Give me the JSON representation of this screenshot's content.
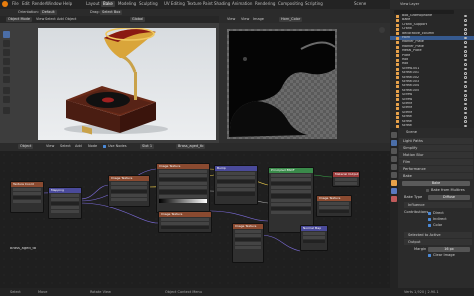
{
  "topbar": {
    "menus": [
      "File",
      "Edit",
      "Render",
      "Window",
      "Help"
    ],
    "workspaces": [
      "Layout",
      "Bake",
      "Modeling",
      "Sculpting",
      "UV Editing",
      "Texture Paint",
      "Shading",
      "Animation",
      "Rendering",
      "Compositing",
      "Scripting"
    ],
    "active_workspace": "Bake",
    "scene_label": "Scene",
    "view_layer_label": "View Layer"
  },
  "viewport_header": {
    "orientation_label": "Orientation:",
    "orientation_value": "Default",
    "drag_label": "Drag:",
    "drag_value": "Select Box",
    "mode": "Object Mode",
    "menus": [
      "View",
      "Select",
      "Add",
      "Object"
    ],
    "global": "Global"
  },
  "image_editor_header": {
    "menus": [
      "View",
      "View",
      "Image"
    ],
    "image_name": "Horn_Color"
  },
  "outliner": {
    "rows": [
      {
        "name": "Box_Gramophone",
        "sel": false,
        "color": "#e8a24a"
      },
      {
        "name": "Bake",
        "sel": false,
        "color": "#e8a24a"
      },
      {
        "name": "Crank_Support",
        "sel": false,
        "color": "#e8a24a"
      },
      {
        "name": "Crank",
        "sel": false,
        "color": "#e8a24a"
      },
      {
        "name": "decorative_column",
        "sel": false,
        "color": "#e8a24a"
      },
      {
        "name": "Horn",
        "sel": true,
        "color": "#e8a24a"
      },
      {
        "name": "Marker_Plate",
        "sel": false,
        "color": "#e8a24a"
      },
      {
        "name": "Marker_Plate",
        "sel": false,
        "color": "#e8a24a"
      },
      {
        "name": "Metal_Plate",
        "sel": false,
        "color": "#e8a24a"
      },
      {
        "name": "Plate",
        "sel": false,
        "color": "#e8a24a"
      },
      {
        "name": "Rod",
        "sel": false,
        "color": "#e8a24a"
      },
      {
        "name": "Rod",
        "sel": false,
        "color": "#e8a24a"
      },
      {
        "name": "Screw.001",
        "sel": false,
        "color": "#e8a24a"
      },
      {
        "name": "screw.001",
        "sel": false,
        "color": "#e8a24a"
      },
      {
        "name": "screw.002",
        "sel": false,
        "color": "#e8a24a"
      },
      {
        "name": "screw.003",
        "sel": false,
        "color": "#e8a24a"
      },
      {
        "name": "screw.004",
        "sel": false,
        "color": "#e8a24a"
      },
      {
        "name": "screw.005",
        "sel": false,
        "color": "#e8a24a"
      },
      {
        "name": "Screw",
        "sel": false,
        "color": "#e8a24a"
      },
      {
        "name": "Screw",
        "sel": false,
        "color": "#e8a24a"
      },
      {
        "name": "Scene",
        "sel": false,
        "color": "#e8a24a"
      },
      {
        "name": "Scene",
        "sel": false,
        "color": "#e8a24a"
      },
      {
        "name": "Scene",
        "sel": false,
        "color": "#e8a24a"
      },
      {
        "name": "screw",
        "sel": false,
        "color": "#e8a24a"
      },
      {
        "name": "screw",
        "sel": false,
        "color": "#e8a24a"
      },
      {
        "name": "screw",
        "sel": false,
        "color": "#e8a24a"
      }
    ]
  },
  "properties": {
    "context": "Scene",
    "sections": [
      "Light Paths",
      "Simplify",
      "Motion Blur",
      "Film",
      "Performance"
    ],
    "bake_section": "Bake",
    "bake_button": "Bake",
    "bake_from_multires": "Bake from Multires",
    "bake_type_label": "Bake Type",
    "bake_type_value": "Diffuse",
    "influence_label": "Influence",
    "contributions_label": "Contributions",
    "direct": "Direct",
    "indirect": "Indirect",
    "color": "Color",
    "selected_to_active": "Selected to Active",
    "output_label": "Output",
    "margin_label": "Margin",
    "margin_value": "16 px",
    "clear_image": "Clear Image"
  },
  "node_editor": {
    "header_menus": [
      "View",
      "Select",
      "Add",
      "Node"
    ],
    "use_nodes": "Use Nodes",
    "slot": "Slot 1",
    "material": "Brass_aged_tb",
    "mode": "Object",
    "material_label": "Brass_aged_tb"
  },
  "nodes": [
    {
      "name": "Texture Coord",
      "color": "#8a4a30"
    },
    {
      "name": "Mapping",
      "color": "#4a4a9a"
    },
    {
      "name": "Image Texture",
      "color": "#8a4a30"
    },
    {
      "name": "Image Texture",
      "color": "#8a4a30"
    },
    {
      "name": "Image Texture",
      "color": "#8a4a30"
    },
    {
      "name": "Bump",
      "color": "#4a4a9a"
    },
    {
      "name": "Principled BSDF",
      "color": "#3a8a4a"
    },
    {
      "name": "Material Output",
      "color": "#9a3a3a"
    },
    {
      "name": "Image Texture",
      "color": "#8a4a30"
    },
    {
      "name": "Normal Map",
      "color": "#4a4a9a"
    },
    {
      "name": "Image Texture",
      "color": "#8a4a30"
    }
  ],
  "status": {
    "select": "Select",
    "move": "Move",
    "rotate": "Rotate View",
    "context": "Object Context Menu",
    "version": "Verts 1,920 | 2.90.1"
  }
}
